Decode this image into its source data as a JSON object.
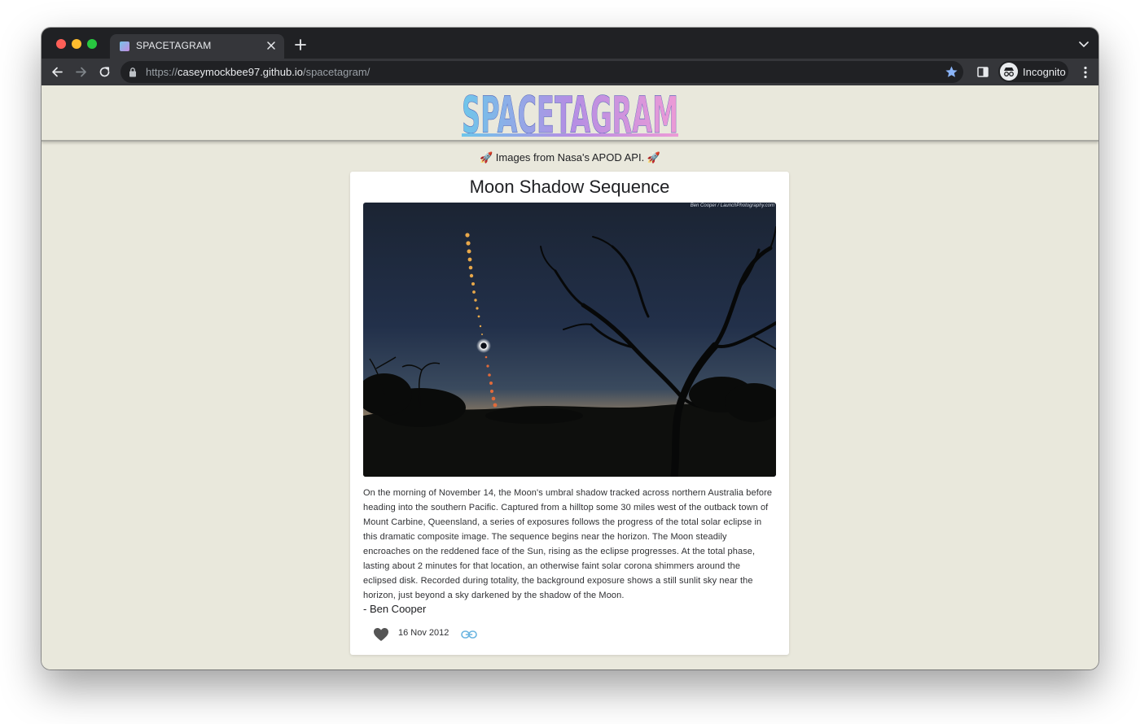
{
  "browser": {
    "tab_title": "SPACETAGRAM",
    "url_scheme": "https://",
    "url_host": "caseymockbee97.github.io",
    "url_path": "/spacetagram/",
    "profile_label": "Incognito"
  },
  "site": {
    "logo_text": "SPACETAGRAM",
    "subtitle": "🚀 Images from Nasa's APOD API. 🚀"
  },
  "post": {
    "title": "Moon Shadow Sequence",
    "image_credit": "Ben Cooper / LaunchPhotography.com",
    "explanation": "On the morning of November 14, the Moon's umbral shadow tracked across northern Australia before heading into the southern Pacific. Captured from a hilltop some 30 miles west of the outback town of Mount Carbine, Queensland, a series of exposures follows the progress of the total solar eclipse in this dramatic composite image. The sequence begins near the horizon. The Moon steadily encroaches on the reddened face of the Sun, rising as the eclipse progresses. At the total phase, lasting about 2 minutes for that location, an otherwise faint solar corona shimmers around the eclipsed disk. Recorded during totality, the background exposure shows a still sunlit sky near the horizon, just beyond a sky darkened by the shadow of the Moon.",
    "author": "- Ben Cooper",
    "date": "16 Nov 2012",
    "liked": false
  },
  "colors": {
    "page_bg": "#e9e8dc",
    "card_bg": "#ffffff",
    "link_icon": "#6ab4e0",
    "heart_icon": "#555555"
  },
  "icons": [
    "back-arrow-icon",
    "forward-arrow-icon",
    "reload-icon",
    "lock-icon",
    "star-icon",
    "side-panel-icon",
    "incognito-icon",
    "kebab-menu-icon",
    "heart-icon",
    "link-icon"
  ]
}
